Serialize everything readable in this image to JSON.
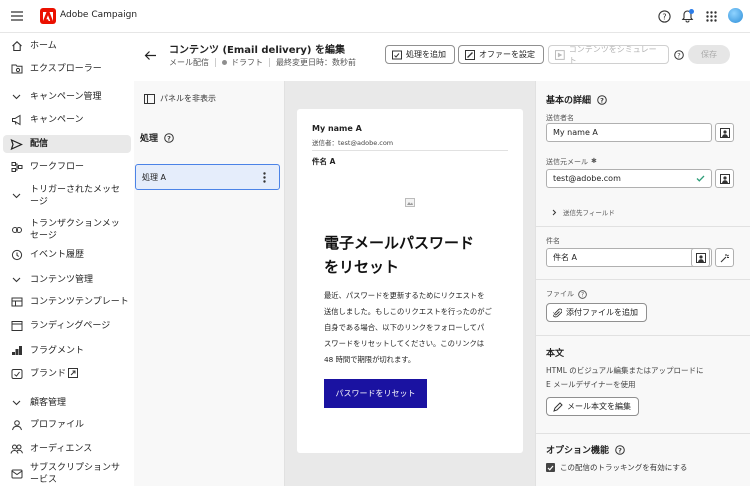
{
  "app": {
    "name": "Adobe Campaign"
  },
  "nav": {
    "home": "ホーム",
    "explorer": "エクスプローラー",
    "campaign_mgmt": "キャンペーン管理",
    "campaigns": "キャンペーン",
    "deliveries": "配信",
    "workflows": "ワークフロー",
    "triggered_1": "トリガーされたメッセ",
    "triggered_2": "ージ",
    "transactional_1": "トランザクションメッ",
    "transactional_2": "セージ",
    "event_history": "イベント履歴",
    "content_mgmt": "コンテンツ管理",
    "content_templates": "コンテンツテンプレート",
    "landing_pages": "ランディングページ",
    "fragments": "フラグメント",
    "brands": "ブランド",
    "customer_mgmt": "顧客管理",
    "profiles": "プロファイル",
    "audiences": "オーディエンス",
    "subscription_1": "サブスクリプションサ",
    "subscription_2": "ービス"
  },
  "header": {
    "title": "コンテンツ (Email delivery) を編集",
    "subtitle_type": "メール配信",
    "subtitle_status": "ドラフト",
    "subtitle_modified": "最終変更日時：数秒前",
    "btn_add_action": "処理を追加",
    "btn_offer": "オファーを設定",
    "btn_simulate": "コンテンツをシミュレート",
    "btn_save": "保存"
  },
  "left": {
    "hide_panel": "パネルを非表示",
    "actions_title": "処理",
    "action_item": "処理 A"
  },
  "preview": {
    "sender_name": "My name A",
    "sender_line": "送信者：test@adobe.com",
    "subject": "件名 A",
    "heading_1": "電子メールパスワード",
    "heading_2": "をリセット",
    "body_1": "最近、パスワードを更新するためにリクエストを",
    "body_2": "送信しました。もしこのリクエストを行ったのがご",
    "body_3": "自身である場合、以下のリンクをフォローしてパ",
    "body_4": "スワードをリセットしてください。このリンクは",
    "body_5": "48 時間で期限が切れます。",
    "cta": "パスワードをリセット"
  },
  "right": {
    "basic_title": "基本の詳細",
    "sender_name_label": "送信者名",
    "sender_name_value": "My name A",
    "sender_email_label": "送信元メール",
    "sender_email_value": "test@adobe.com",
    "recipient_fields": "送信先フィールド",
    "subject_label": "件名",
    "subject_value": "件名 A",
    "file_label": "ファイル",
    "attach_btn": "添付ファイルを追加",
    "body_title": "本文",
    "body_desc_1": "HTML のビジュアル編集またはアップロードに",
    "body_desc_2": "E メールデザイナーを使用",
    "edit_body_btn": "メール本文を編集",
    "options_title": "オプション機能",
    "tracking_label": "この配信のトラッキングを有効にする"
  },
  "colors": {
    "accent": "#1a12a1",
    "adobe_red": "#eb1000",
    "selected": "#e5edfb"
  }
}
